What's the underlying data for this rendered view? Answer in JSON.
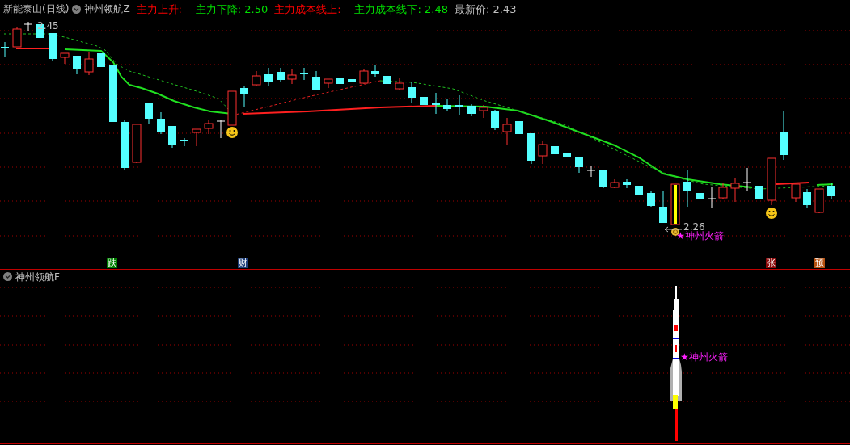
{
  "header": {
    "stock_title": "新能泰山(日线)",
    "indicator_name": "神州领航Z",
    "readings": [
      {
        "text": "主力上升: -",
        "color": "#ff0000"
      },
      {
        "text": "主力下降: 2.50",
        "color": "#00e000"
      },
      {
        "text": "主力成本线上: -",
        "color": "#ff0000"
      },
      {
        "text": "主力成本线下: 2.48",
        "color": "#00e000"
      },
      {
        "text": "最新价: 2.43",
        "color": "#c0c0c0"
      }
    ]
  },
  "main_chart": {
    "high_label": "2.45",
    "low_label": "2.26",
    "signal_label": "★神州火箭",
    "badges": [
      {
        "text": "跌",
        "color": "#008000"
      },
      {
        "text": "财",
        "color": "#1e3f7a"
      },
      {
        "text": "张",
        "color": "#8b0a0a"
      },
      {
        "text": "预",
        "color": "#b5500f"
      }
    ]
  },
  "lower_panel": {
    "title": "神州领航F",
    "signal_label": "★神州火箭"
  }
}
